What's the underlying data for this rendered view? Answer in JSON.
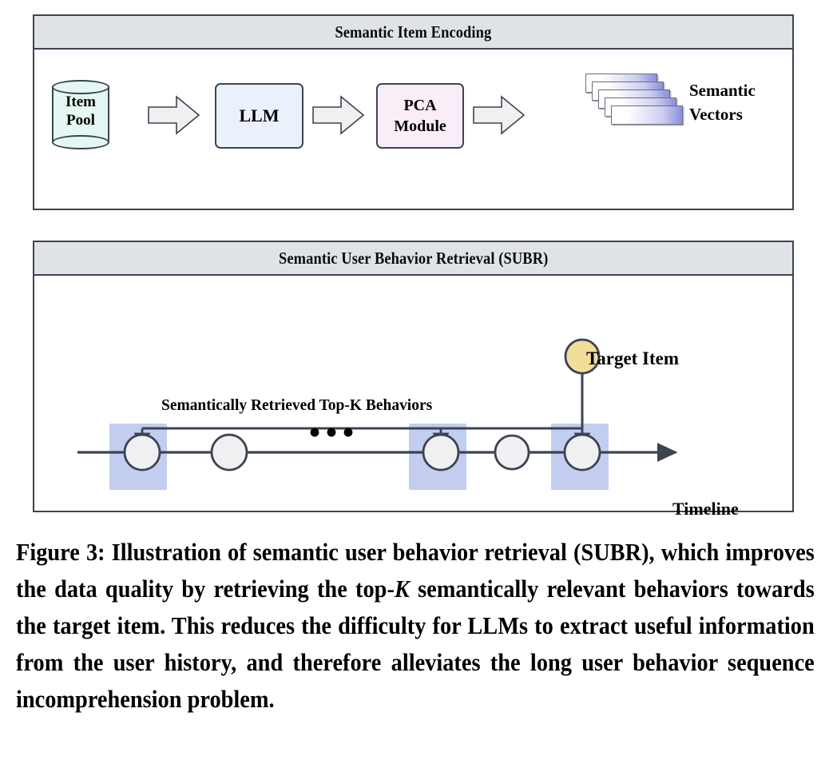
{
  "figure": {
    "number": "Figure 3",
    "caption_parts": {
      "lead": "Figure 3: Illustration of semantic user behavior retrieval (SUBR), which improves the data quality by retrieving the top-",
      "italic_symbol": "K",
      "tail": " semantically relevant behaviors towards the target item. This reduces the difficulty for LLMs to extract useful information from the user history, and therefore alleviates the long user behavior sequence incomprehension problem."
    },
    "caption_full": "Figure 3: Illustration of semantic user behavior retrieval (SUBR), which improves the data quality by retrieving the top-K semantically relevant behaviors towards the target item. This reduces the difficulty for LLMs to extract useful information from the user history, and therefore alleviates the long user behavior sequence incomprehension problem."
  },
  "panels": [
    {
      "id": "semantic-item-encoding",
      "title": "Semantic Item Encoding",
      "nodes": [
        {
          "id": "item-pool",
          "shape": "cylinder",
          "label_line1": "Item",
          "label_line2": "Pool",
          "fill": "#e4f7f2",
          "stroke": "#3c4452"
        },
        {
          "id": "llm",
          "shape": "rounded-rect",
          "label": "LLM",
          "fill": "#eaf1fb",
          "stroke": "#3c4452"
        },
        {
          "id": "pca-module",
          "shape": "rounded-rect",
          "label_line1": "PCA",
          "label_line2": "Module",
          "fill": "#f9eef8",
          "stroke": "#3c4452"
        },
        {
          "id": "semantic-vectors",
          "shape": "stacked-bars",
          "label_line1": "Semantic",
          "label_line2": "Vectors",
          "count": 5,
          "gradient_from": "#ffffff",
          "gradient_to": "#8a8ede"
        }
      ],
      "connectors": [
        {
          "id": "arrow-pool-to-llm",
          "type": "block-arrow",
          "direction": "right"
        },
        {
          "id": "arrow-llm-to-pca",
          "type": "block-arrow",
          "direction": "right"
        },
        {
          "id": "arrow-pca-to-vectors",
          "type": "block-arrow",
          "direction": "right"
        }
      ]
    },
    {
      "id": "semantic-user-behavior-retrieval",
      "title": "Semantic User Behavior Retrieval (SUBR)",
      "labels": {
        "target_item": "Target Item",
        "topk_bracket": "Semantically Retrieved Top-K Behaviors",
        "timeline": "Timeline"
      },
      "target_item": {
        "fill": "#f2dd9b",
        "stroke": "#3c4452"
      },
      "ellipsis": "• • •",
      "behaviors": [
        {
          "index": 1,
          "retrieved": true
        },
        {
          "index": 2,
          "retrieved": false
        },
        {
          "index": 3,
          "retrieved": true
        },
        {
          "index": 4,
          "retrieved": false
        },
        {
          "index": 5,
          "retrieved": true
        }
      ],
      "colors": {
        "highlight_box": "#c2cdf0",
        "behavior_fill": "#f0f0f2",
        "stroke": "#3c4452",
        "timeline_line": "#3c4452"
      }
    }
  ]
}
